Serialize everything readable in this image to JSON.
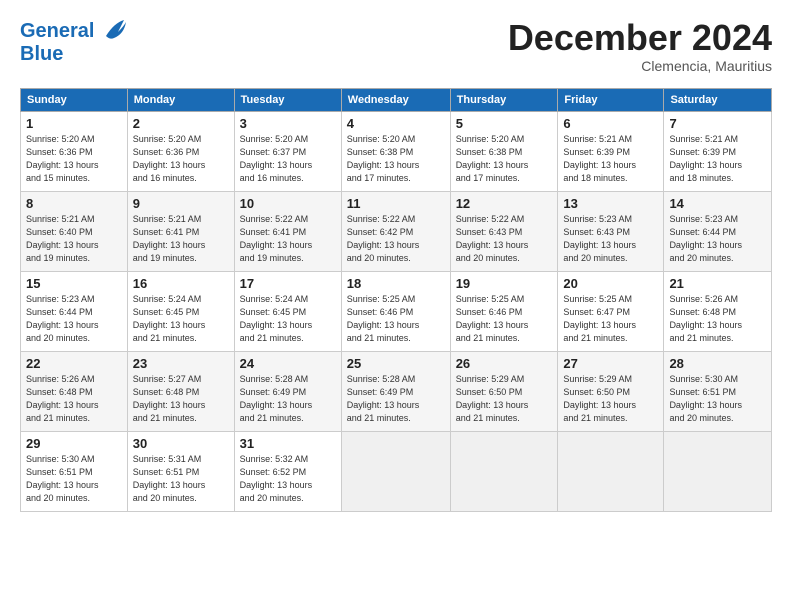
{
  "header": {
    "logo_line1": "General",
    "logo_line2": "Blue",
    "month_year": "December 2024",
    "location": "Clemencia, Mauritius"
  },
  "weekdays": [
    "Sunday",
    "Monday",
    "Tuesday",
    "Wednesday",
    "Thursday",
    "Friday",
    "Saturday"
  ],
  "weeks": [
    [
      {
        "day": "1",
        "info": "Sunrise: 5:20 AM\nSunset: 6:36 PM\nDaylight: 13 hours\nand 15 minutes."
      },
      {
        "day": "2",
        "info": "Sunrise: 5:20 AM\nSunset: 6:36 PM\nDaylight: 13 hours\nand 16 minutes."
      },
      {
        "day": "3",
        "info": "Sunrise: 5:20 AM\nSunset: 6:37 PM\nDaylight: 13 hours\nand 16 minutes."
      },
      {
        "day": "4",
        "info": "Sunrise: 5:20 AM\nSunset: 6:38 PM\nDaylight: 13 hours\nand 17 minutes."
      },
      {
        "day": "5",
        "info": "Sunrise: 5:20 AM\nSunset: 6:38 PM\nDaylight: 13 hours\nand 17 minutes."
      },
      {
        "day": "6",
        "info": "Sunrise: 5:21 AM\nSunset: 6:39 PM\nDaylight: 13 hours\nand 18 minutes."
      },
      {
        "day": "7",
        "info": "Sunrise: 5:21 AM\nSunset: 6:39 PM\nDaylight: 13 hours\nand 18 minutes."
      }
    ],
    [
      {
        "day": "8",
        "info": "Sunrise: 5:21 AM\nSunset: 6:40 PM\nDaylight: 13 hours\nand 19 minutes."
      },
      {
        "day": "9",
        "info": "Sunrise: 5:21 AM\nSunset: 6:41 PM\nDaylight: 13 hours\nand 19 minutes."
      },
      {
        "day": "10",
        "info": "Sunrise: 5:22 AM\nSunset: 6:41 PM\nDaylight: 13 hours\nand 19 minutes."
      },
      {
        "day": "11",
        "info": "Sunrise: 5:22 AM\nSunset: 6:42 PM\nDaylight: 13 hours\nand 20 minutes."
      },
      {
        "day": "12",
        "info": "Sunrise: 5:22 AM\nSunset: 6:43 PM\nDaylight: 13 hours\nand 20 minutes."
      },
      {
        "day": "13",
        "info": "Sunrise: 5:23 AM\nSunset: 6:43 PM\nDaylight: 13 hours\nand 20 minutes."
      },
      {
        "day": "14",
        "info": "Sunrise: 5:23 AM\nSunset: 6:44 PM\nDaylight: 13 hours\nand 20 minutes."
      }
    ],
    [
      {
        "day": "15",
        "info": "Sunrise: 5:23 AM\nSunset: 6:44 PM\nDaylight: 13 hours\nand 20 minutes."
      },
      {
        "day": "16",
        "info": "Sunrise: 5:24 AM\nSunset: 6:45 PM\nDaylight: 13 hours\nand 21 minutes."
      },
      {
        "day": "17",
        "info": "Sunrise: 5:24 AM\nSunset: 6:45 PM\nDaylight: 13 hours\nand 21 minutes."
      },
      {
        "day": "18",
        "info": "Sunrise: 5:25 AM\nSunset: 6:46 PM\nDaylight: 13 hours\nand 21 minutes."
      },
      {
        "day": "19",
        "info": "Sunrise: 5:25 AM\nSunset: 6:46 PM\nDaylight: 13 hours\nand 21 minutes."
      },
      {
        "day": "20",
        "info": "Sunrise: 5:25 AM\nSunset: 6:47 PM\nDaylight: 13 hours\nand 21 minutes."
      },
      {
        "day": "21",
        "info": "Sunrise: 5:26 AM\nSunset: 6:48 PM\nDaylight: 13 hours\nand 21 minutes."
      }
    ],
    [
      {
        "day": "22",
        "info": "Sunrise: 5:26 AM\nSunset: 6:48 PM\nDaylight: 13 hours\nand 21 minutes."
      },
      {
        "day": "23",
        "info": "Sunrise: 5:27 AM\nSunset: 6:48 PM\nDaylight: 13 hours\nand 21 minutes."
      },
      {
        "day": "24",
        "info": "Sunrise: 5:28 AM\nSunset: 6:49 PM\nDaylight: 13 hours\nand 21 minutes."
      },
      {
        "day": "25",
        "info": "Sunrise: 5:28 AM\nSunset: 6:49 PM\nDaylight: 13 hours\nand 21 minutes."
      },
      {
        "day": "26",
        "info": "Sunrise: 5:29 AM\nSunset: 6:50 PM\nDaylight: 13 hours\nand 21 minutes."
      },
      {
        "day": "27",
        "info": "Sunrise: 5:29 AM\nSunset: 6:50 PM\nDaylight: 13 hours\nand 21 minutes."
      },
      {
        "day": "28",
        "info": "Sunrise: 5:30 AM\nSunset: 6:51 PM\nDaylight: 13 hours\nand 20 minutes."
      }
    ],
    [
      {
        "day": "29",
        "info": "Sunrise: 5:30 AM\nSunset: 6:51 PM\nDaylight: 13 hours\nand 20 minutes."
      },
      {
        "day": "30",
        "info": "Sunrise: 5:31 AM\nSunset: 6:51 PM\nDaylight: 13 hours\nand 20 minutes."
      },
      {
        "day": "31",
        "info": "Sunrise: 5:32 AM\nSunset: 6:52 PM\nDaylight: 13 hours\nand 20 minutes."
      },
      {
        "day": "",
        "info": ""
      },
      {
        "day": "",
        "info": ""
      },
      {
        "day": "",
        "info": ""
      },
      {
        "day": "",
        "info": ""
      }
    ]
  ]
}
